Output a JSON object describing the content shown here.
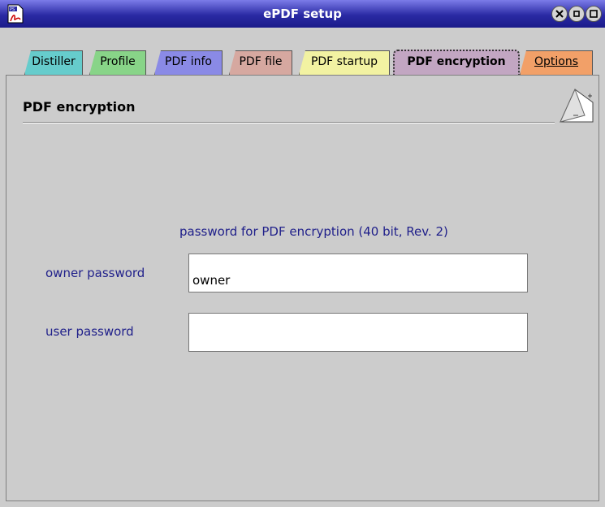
{
  "window": {
    "title": "ePDF setup"
  },
  "icons": {
    "app": "pdf-document-icon",
    "close": "close-icon",
    "minimize": "minimize-icon",
    "maximize": "maximize-icon",
    "page_corner": "page-curl-icon"
  },
  "tabs": [
    {
      "label": "Distiller",
      "color": "#66cccc"
    },
    {
      "label": "Profile",
      "color": "#88d488"
    },
    {
      "label": "PDF info",
      "color": "#8a8ae6"
    },
    {
      "label": "PDF file",
      "color": "#d6a8a0"
    },
    {
      "label": "PDF startup",
      "color": "#f2f2a2"
    },
    {
      "label": "PDF encryption",
      "color": "#c2a6c2",
      "active": true
    },
    {
      "label": "Options",
      "color": "#f2a068"
    }
  ],
  "page": {
    "title": "PDF encryption",
    "subtitle": "password for PDF encryption (40 bit, Rev. 2)",
    "owner_label": "owner password",
    "owner_value": "owner",
    "user_label": "user password",
    "user_value": ""
  }
}
